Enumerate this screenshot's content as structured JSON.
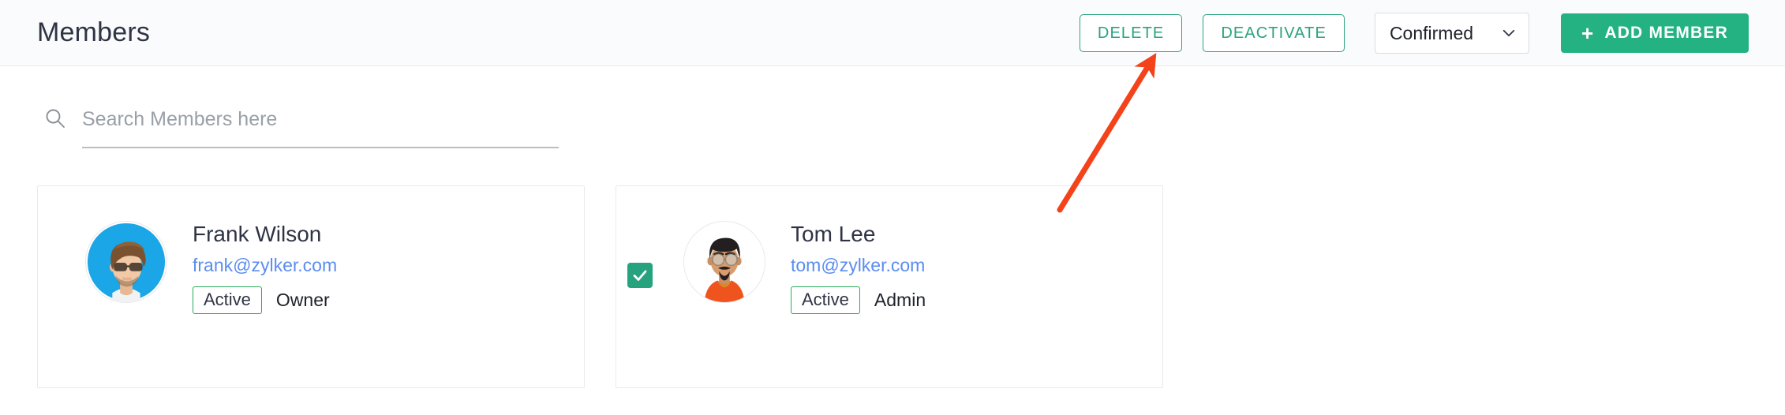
{
  "header": {
    "title": "Members",
    "delete_label": "DELETE",
    "deactivate_label": "DEACTIVATE",
    "filter": {
      "selected": "Confirmed",
      "chevron_icon": "chevron-down-icon"
    },
    "add_member": {
      "plus": "+",
      "label": "ADD MEMBER"
    }
  },
  "search": {
    "placeholder": "Search Members here",
    "value": "",
    "icon": "search-icon"
  },
  "members": [
    {
      "name": "Frank Wilson",
      "email": "frank@zylker.com",
      "status": "Active",
      "role": "Owner",
      "selected": false,
      "avatar": "frank-avatar"
    },
    {
      "name": "Tom Lee",
      "email": "tom@zylker.com",
      "status": "Active",
      "role": "Admin",
      "selected": true,
      "avatar": "tom-avatar"
    }
  ],
  "annotation": {
    "type": "arrow",
    "color": "#f4421a",
    "points_to": "deactivate-button"
  },
  "colors": {
    "accent_green": "#25b283",
    "outline_green": "#2aa37f",
    "status_green": "#2bab5f",
    "email_blue": "#5b8def",
    "title_navy": "#2f3445",
    "annotation_red": "#f4421a"
  }
}
